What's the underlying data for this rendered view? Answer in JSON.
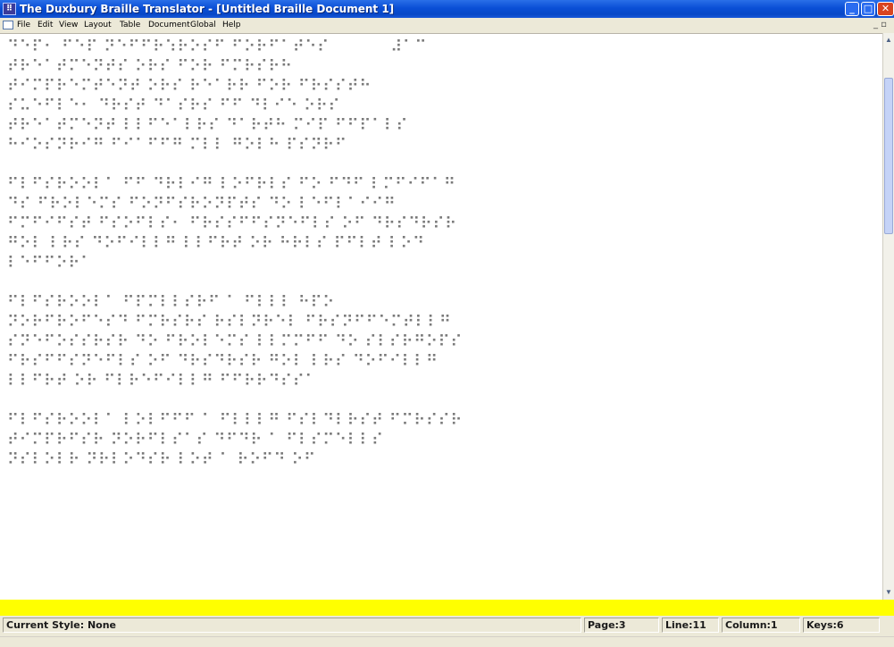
{
  "window": {
    "title": "The Duxbury Braille Translator - [Untitled Braille Document 1]",
    "minimize_glyph": "_",
    "maximize_glyph": "□",
    "close_glyph": "✕"
  },
  "menu": {
    "items": [
      "File",
      "Edit",
      "View",
      "Layout",
      "Table",
      "Document",
      "Global",
      "Help"
    ],
    "mdi_controls": "_ ▫"
  },
  "document": {
    "lines": [
      "⠙⠑⠏⠂ ⠋⠑⠏ ⠝⠑⠋⠋⠗⠱⠗⠕⠎⠋ ⠋⠕⠗⠋⠁⠞⠑⠎           ⠼⠁⠉",
      "⠞⠗⠑⠁⠞⠍⠑⠝⠞⠎ ⠕⠗⠎ ⠋⠕⠗ ⠋⠍⠗⠎⠗⠓",
      "⠞⠊⠍⠏⠗⠑⠍⠞⠑⠝⠞ ⠕⠗⠎ ⠗⠑⠁⠗⠗ ⠋⠕⠗ ⠋⠗⠎⠎⠞⠓",
      "⠎⠥⠑⠋⠇⠑⠂ ⠙⠗⠎⠞ ⠙⠁⠎⠗⠎ ⠋⠋ ⠙⠇⠊⠑ ⠕⠗⠎",
      "⠞⠗⠑⠁⠞⠍⠑⠝⠞ ⠇⠇⠋⠑⠁⠇⠗⠎ ⠙⠁⠗⠞⠓ ⠍⠊⠏ ⠋⠋⠏⠁⠇⠎",
      "⠓⠊⠕⠎⠝⠗⠊⠛ ⠋⠊⠁⠋⠋⠛ ⠍⠇⠇ ⠛⠕⠇⠓ ⠏⠎⠝⠗⠋",
      "",
      "⠋⠇⠋⠎⠗⠕⠕⠇⠁ ⠋⠋ ⠙⠗⠇⠊⠛ ⠇⠕⠋⠗⠇⠎ ⠋⠕ ⠋⠙⠋ ⠇⠍⠋⠊⠋⠁⠛",
      "⠙⠎ ⠋⠗⠕⠇⠑⠍⠎ ⠋⠕⠝⠋⠎⠗⠕⠝⠏⠞⠎ ⠙⠕ ⠇⠑⠋⠇⠁⠊⠊⠛",
      "⠋⠍⠋⠊⠋⠎⠞ ⠋⠎⠕⠋⠇⠎⠂ ⠋⠗⠎⠎⠋⠋⠎⠝⠑⠋⠇⠎ ⠕⠋ ⠙⠗⠎⠙⠗⠎⠗",
      "⠛⠕⠇ ⠇⠗⠎ ⠙⠕⠋⠊⠇⠇⠛ ⠇⠇⠋⠗⠞ ⠕⠗ ⠓⠗⠇⠎ ⠏⠋⠇⠞ ⠇⠕⠙",
      "⠇⠑⠋⠋⠕⠗⠁",
      "",
      "⠋⠇⠋⠎⠗⠕⠕⠇⠁ ⠋⠏⠍⠇⠇⠎⠗⠋ ⠁ ⠋⠇⠇⠇ ⠓⠏⠕",
      "⠝⠕⠗⠋⠗⠕⠋⠑⠎⠙ ⠋⠍⠗⠎⠗⠎ ⠗⠎⠇⠝⠗⠑⠇ ⠋⠗⠎⠝⠋⠋⠑⠍⠞⠇⠇⠛",
      "⠎⠝⠑⠋⠕⠎⠎⠗⠎⠗ ⠙⠕ ⠋⠗⠕⠇⠑⠍⠎ ⠇⠇⠍⠍⠋⠋ ⠙⠕ ⠎⠇⠎⠗⠛⠕⠏⠎",
      "⠋⠗⠎⠋⠋⠎⠝⠑⠋⠇⠎ ⠕⠋ ⠙⠗⠎⠙⠗⠎⠗ ⠛⠕⠇ ⠇⠗⠎ ⠙⠕⠋⠊⠇⠇⠛",
      "⠇⠇⠋⠗⠞ ⠕⠗ ⠋⠇⠗⠑⠋⠊⠇⠇⠛ ⠋⠋⠗⠗⠙⠎⠎⠁",
      "",
      "⠋⠇⠋⠎⠗⠕⠕⠇⠁ ⠇⠕⠇⠋⠋⠋ ⠁ ⠋⠇⠇⠇⠛ ⠋⠎⠇⠙⠇⠗⠎⠞ ⠋⠍⠗⠎⠎⠗",
      "⠞⠊⠍⠏⠗⠋⠎⠗ ⠝⠕⠗⠋⠇⠎⠁⠎ ⠙⠋⠙⠗ ⠁ ⠋⠇⠎⠍⠑⠇⠇⠎",
      "⠝⠎⠇⠕⠇⠗ ⠝⠗⠇⠕⠙⠎⠗ ⠇⠕⠞ ⠁ ⠗⠕⠋⠙ ⠕⠋"
    ]
  },
  "status": {
    "style": "Current Style: None",
    "page": "Page:3",
    "line": "Line:11",
    "column": "Column:1",
    "keys": "Keys:6"
  },
  "colors": {
    "title_bar": "#0a4fd6",
    "highlight_bar": "#ffff00",
    "braille_text": "#7a7a7a"
  }
}
